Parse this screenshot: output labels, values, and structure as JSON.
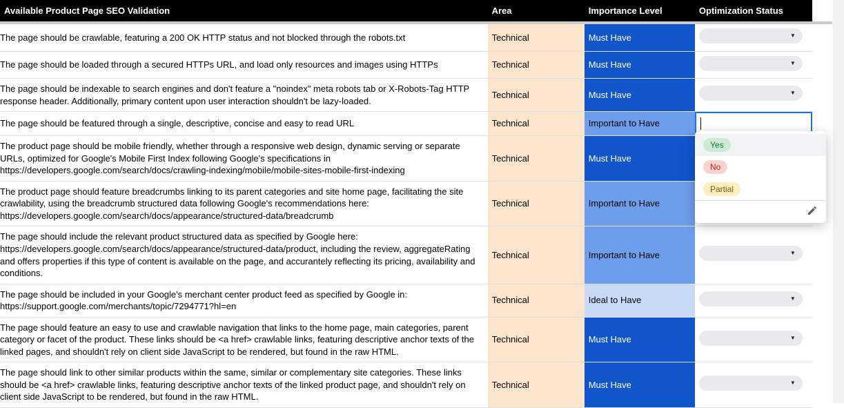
{
  "headers": {
    "validation": "Available Product Page SEO Validation",
    "area": "Area",
    "importance": "Importance Level",
    "status": "Optimization Status"
  },
  "rows": [
    {
      "validation": "The page should be crawlable, featuring a 200 OK HTTP status and not blocked through the robots.txt",
      "area": "Technical",
      "importance": "Must Have",
      "imp_class": "imp-must",
      "status_mode": "pill"
    },
    {
      "validation": "The page should be loaded through a secured HTTPs URL, and load only resources and images using HTTPs",
      "area": "Technical",
      "importance": "Must Have",
      "imp_class": "imp-must",
      "status_mode": "pill"
    },
    {
      "validation": "The page should be indexable to search engines and don't feature a \"noindex\" meta robots tab or X-Robots-Tag HTTP response header. Additionally, primary content upon user interaction shouldn't be lazy-loaded.",
      "area": "Technical",
      "importance": "Must Have",
      "imp_class": "imp-must",
      "status_mode": "pill"
    },
    {
      "validation": "The page should be featured through a single, descriptive, concise and easy to read URL",
      "area": "Technical",
      "importance": "Important to Have",
      "imp_class": "imp-important",
      "status_mode": "active"
    },
    {
      "validation": "The product page should be mobile friendly, whether through a responsive web design, dynamic serving or separate URLs, optimized for Google's Mobile First Index following Google's specifications in https://developers.google.com/search/docs/crawling-indexing/mobile/mobile-sites-mobile-first-indexing",
      "area": "Technical",
      "importance": "Must Have",
      "imp_class": "imp-must",
      "status_mode": "pill"
    },
    {
      "validation": "The product page should feature breadcrumbs linking to its parent categories and site home page, facilitating the site crawlability, using the breadcrumb structured data following Google's recommendations here: https://developers.google.com/search/docs/appearance/structured-data/breadcrumb",
      "area": "Technical",
      "importance": "Important to Have",
      "imp_class": "imp-important",
      "status_mode": "pill"
    },
    {
      "validation": "The page should include the relevant product structured data as specified by Google here: https://developers.google.com/search/docs/appearance/structured-data/product, including the review, aggregateRating and offers properties if this type of content is available on the page, and accurantely reflecting its pricing, availability and conditions.",
      "area": "Technical",
      "importance": "Important to Have",
      "imp_class": "imp-important",
      "status_mode": "pill"
    },
    {
      "validation": "The page should be included in your Google's merchant center product feed as specified by Google in: https://support.google.com/merchants/topic/7294771?hl=en",
      "area": "Technical",
      "importance": "Ideal to Have",
      "imp_class": "imp-ideal",
      "status_mode": "pill"
    },
    {
      "validation": "The page should feature an easy to use and crawlable navigation that links to the home page, main categories, parent category or facet of the product. These links should be <a href> crawlable links, featuring descriptive anchor texts of the linked pages, and shouldn't rely on client side JavaScript to be rendered, but found in the raw HTML.",
      "area": "Technical",
      "importance": "Must Have",
      "imp_class": "imp-must",
      "status_mode": "pill"
    },
    {
      "validation": "The page should link to other similar products within the same, similar or complementary site categories. These links should be <a href> crawlable links, featuring descriptive anchor texts of the linked product page, and shouldn't rely on client side JavaScript to be rendered, but found in the raw HTML.",
      "area": "Technical",
      "importance": "Must Have",
      "imp_class": "imp-must",
      "status_mode": "pill"
    }
  ],
  "dropdown": {
    "options": {
      "yes": "Yes",
      "no": "No",
      "partial": "Partial"
    }
  }
}
